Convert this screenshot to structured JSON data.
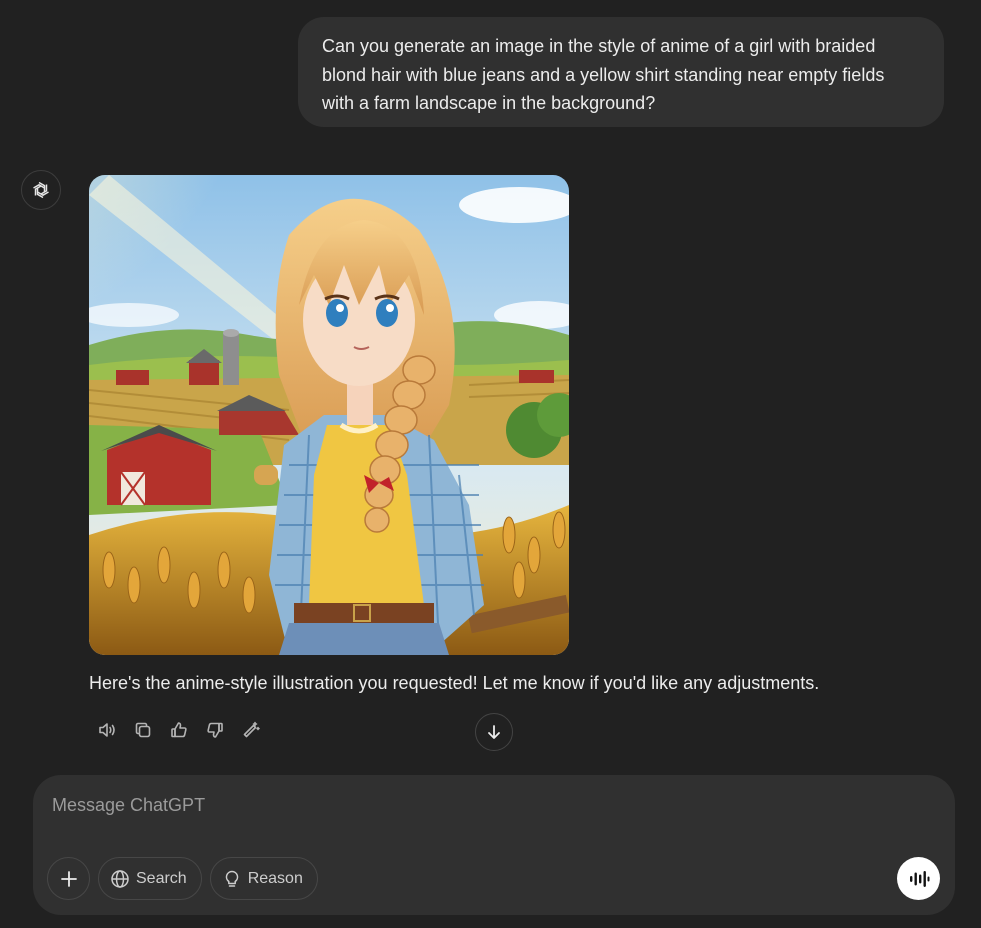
{
  "conversation": {
    "user_message": "Can you generate an image in the style of anime of a girl with braided blond hair with blue jeans and a yellow shirt standing near empty fields with a farm landscape in the background?",
    "assistant_message": "Here's the anime-style illustration you requested! Let me know if you'd like any adjustments.",
    "assistant_icon": "openai-logo-icon",
    "image_icon": "generated-image"
  },
  "actions": [
    {
      "name": "read-aloud-button",
      "icon": "speaker-icon"
    },
    {
      "name": "copy-button",
      "icon": "copy-icon"
    },
    {
      "name": "good-response-button",
      "icon": "thumbs-up-icon"
    },
    {
      "name": "bad-response-button",
      "icon": "thumbs-down-icon"
    },
    {
      "name": "edit-image-button",
      "icon": "wand-icon"
    }
  ],
  "composer": {
    "placeholder": "Message ChatGPT",
    "search_label": "Search",
    "reason_label": "Reason"
  },
  "colors": {
    "background": "#212121",
    "bubble": "#303030",
    "text": "#ececec",
    "placeholder": "#9b9b9b"
  }
}
